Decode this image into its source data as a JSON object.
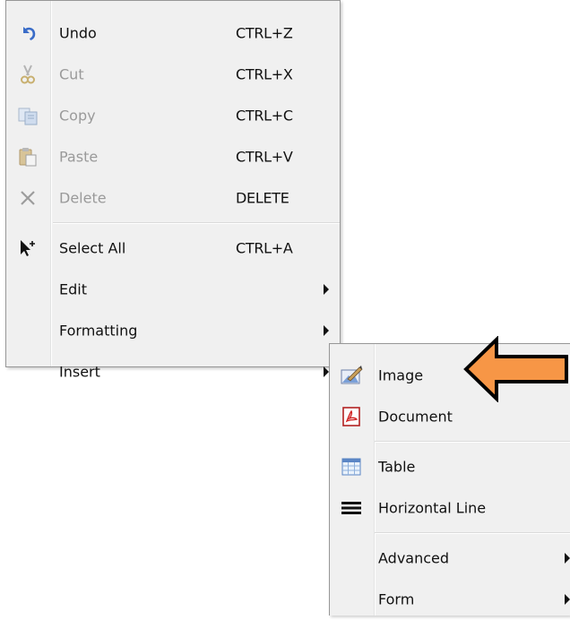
{
  "main_menu": {
    "items": [
      {
        "label": "Undo",
        "shortcut": "CTRL+Z",
        "icon": "undo-icon",
        "enabled": true
      },
      {
        "label": "Cut",
        "shortcut": "CTRL+X",
        "icon": "scissors-icon",
        "enabled": false
      },
      {
        "label": "Copy",
        "shortcut": "CTRL+C",
        "icon": "copy-icon",
        "enabled": false
      },
      {
        "label": "Paste",
        "shortcut": "CTRL+V",
        "icon": "paste-icon",
        "enabled": false
      },
      {
        "label": "Delete",
        "shortcut": "DELETE",
        "icon": "x-icon",
        "enabled": false
      },
      {
        "label": "Select All",
        "shortcut": "CTRL+A",
        "icon": "select-all-cursor-icon",
        "enabled": true
      },
      {
        "label": "Edit",
        "submenu": true
      },
      {
        "label": "Formatting",
        "submenu": true
      },
      {
        "label": "Insert",
        "submenu": true
      }
    ]
  },
  "insert_submenu": {
    "items": [
      {
        "label": "Image",
        "icon": "image-icon"
      },
      {
        "label": "Document",
        "icon": "pdf-document-icon"
      },
      {
        "label": "Table",
        "icon": "table-icon"
      },
      {
        "label": "Horizontal Line",
        "icon": "horizontal-line-icon"
      },
      {
        "label": "Advanced",
        "submenu": true
      },
      {
        "label": "Form",
        "submenu": true
      }
    ]
  },
  "colors": {
    "menu_bg": "#f0f0f0",
    "menu_border": "#979797",
    "disabled_text": "#9a9a9a",
    "callout_arrow": "#f79646"
  }
}
